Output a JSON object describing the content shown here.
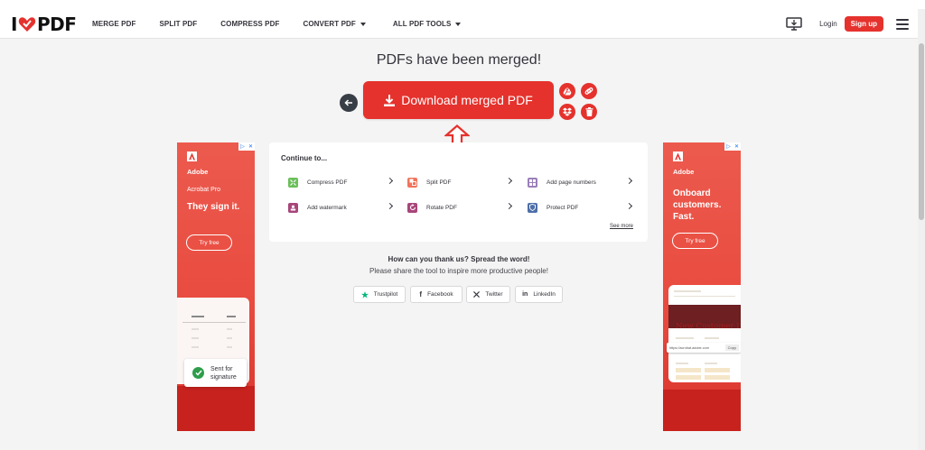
{
  "header": {
    "logo_left": "I",
    "logo_right": "PDF",
    "nav": [
      {
        "label": "MERGE PDF",
        "dropdown": false
      },
      {
        "label": "SPLIT PDF",
        "dropdown": false
      },
      {
        "label": "COMPRESS PDF",
        "dropdown": false
      },
      {
        "label": "CONVERT PDF",
        "dropdown": true
      },
      {
        "label": "ALL PDF TOOLS",
        "dropdown": true
      }
    ],
    "login": "Login",
    "signup": "Sign up"
  },
  "main": {
    "title": "PDFs have been merged!",
    "download_label": "Download merged PDF"
  },
  "continue": {
    "title": "Continue to...",
    "tools": [
      {
        "label": "Compress PDF",
        "color": "#6bbf59",
        "icon": "compress-icon"
      },
      {
        "label": "Split PDF",
        "color": "#f0745b",
        "icon": "split-icon"
      },
      {
        "label": "Add page numbers",
        "color": "#9a7fb8",
        "icon": "page-numbers-icon"
      },
      {
        "label": "Add watermark",
        "color": "#a8467a",
        "icon": "watermark-icon"
      },
      {
        "label": "Rotate PDF",
        "color": "#a8467a",
        "icon": "rotate-icon"
      },
      {
        "label": "Protect PDF",
        "color": "#4e6fa8",
        "icon": "protect-icon"
      }
    ],
    "see_more": "See more"
  },
  "share": {
    "heading": "How can you thank us? Spread the word!",
    "subheading": "Please share the tool to inspire more productive people!",
    "buttons": [
      {
        "label": "Trustpilot",
        "icon": "trustpilot-star-icon",
        "color": "#00b67a"
      },
      {
        "label": "Facebook",
        "icon": "facebook-icon",
        "color": "#33333b"
      },
      {
        "label": "Twitter",
        "icon": "x-icon",
        "color": "#33333b"
      },
      {
        "label": "LinkedIn",
        "icon": "linkedin-icon",
        "color": "#33333b"
      }
    ]
  },
  "ad_left": {
    "brand": "Adobe",
    "product": "Acrobat Pro",
    "headline": "They sign it.",
    "cta": "Try free",
    "card_text_1": "Sent for",
    "card_text_2": "signature"
  },
  "ad_right": {
    "brand": "Adobe",
    "headline_1": "Onboard",
    "headline_2": "customers.",
    "headline_3": "Fast.",
    "cta": "Try free",
    "doc_title": "New Customer I",
    "url_text": "https://acrobat.adobe.com",
    "copy_label": "Copy"
  },
  "colors": {
    "brand_red": "#e5322d",
    "text_dark": "#33333b",
    "background": "#f4f4f4"
  }
}
